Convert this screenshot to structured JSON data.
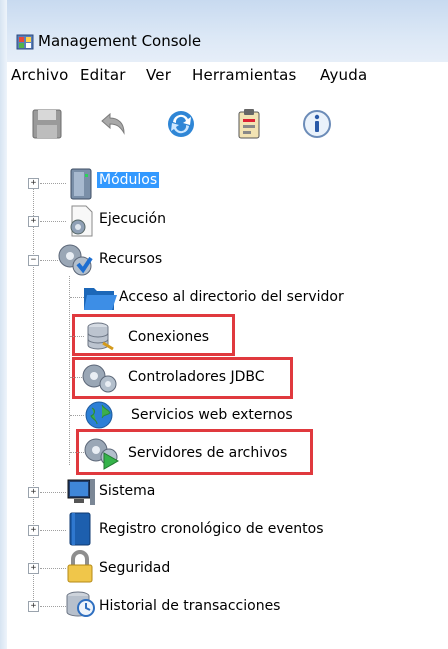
{
  "window": {
    "title": "Management Console",
    "app_icon": "console-icon"
  },
  "menu": [
    "Archivo",
    "Editar",
    "Ver",
    "Herramientas",
    "Ayuda"
  ],
  "toolbar": [
    {
      "name": "save-icon"
    },
    {
      "name": "undo-icon"
    },
    {
      "name": "refresh-icon"
    },
    {
      "name": "clipboard-icon"
    },
    {
      "name": "info-icon"
    }
  ],
  "tree": {
    "modulos": "Módulos",
    "ejecucion": "Ejecución",
    "recursos": "Recursos",
    "acceso": "Acceso al directorio del servidor",
    "conexiones": "Conexiones",
    "controladores": "Controladores JDBC",
    "servicios": "Servicios web externos",
    "servidores": "Servidores de archivos",
    "sistema": "Sistema",
    "registro": "Registro cronológico de eventos",
    "seguridad": "Seguridad",
    "historial": "Historial de transacciones"
  },
  "colors": {
    "selection": "#3399ff",
    "highlight_border": "#e0393e"
  }
}
